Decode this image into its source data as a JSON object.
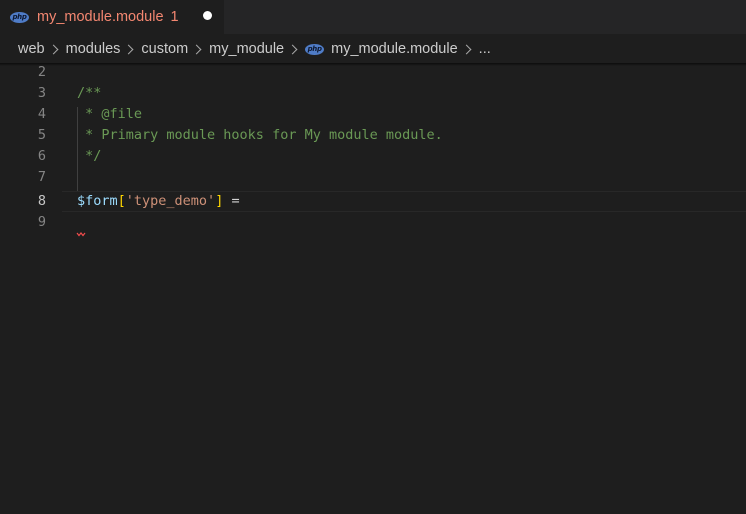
{
  "tab": {
    "icon": "php-file-icon",
    "icon_text": "php",
    "title": "my_module.module",
    "problem_count": "1",
    "unsaved": true
  },
  "breadcrumb": {
    "items": [
      "web",
      "modules",
      "custom",
      "my_module"
    ],
    "file_icon_text": "php",
    "file": "my_module.module",
    "more": "..."
  },
  "editor": {
    "active_line": 8,
    "lines": [
      {
        "number": "2",
        "text": ""
      },
      {
        "number": "3",
        "text": "/**"
      },
      {
        "number": "4",
        "text": " * @file"
      },
      {
        "number": "5",
        "text": " * Primary module hooks for My module module."
      },
      {
        "number": "6",
        "text": " */"
      },
      {
        "number": "7",
        "text": ""
      },
      {
        "number": "8",
        "tokens": {
          "var": "$form",
          "open": "[",
          "str": "'type_demo'",
          "close": "]",
          "op": " ="
        }
      },
      {
        "number": "9",
        "text": ""
      }
    ]
  },
  "colors": {
    "tab_error": "#f48771",
    "comment": "#6a9955",
    "variable": "#9cdcfe",
    "bracket": "#ffd700",
    "string": "#ce9178",
    "error_squiggle": "#f14c4c"
  }
}
